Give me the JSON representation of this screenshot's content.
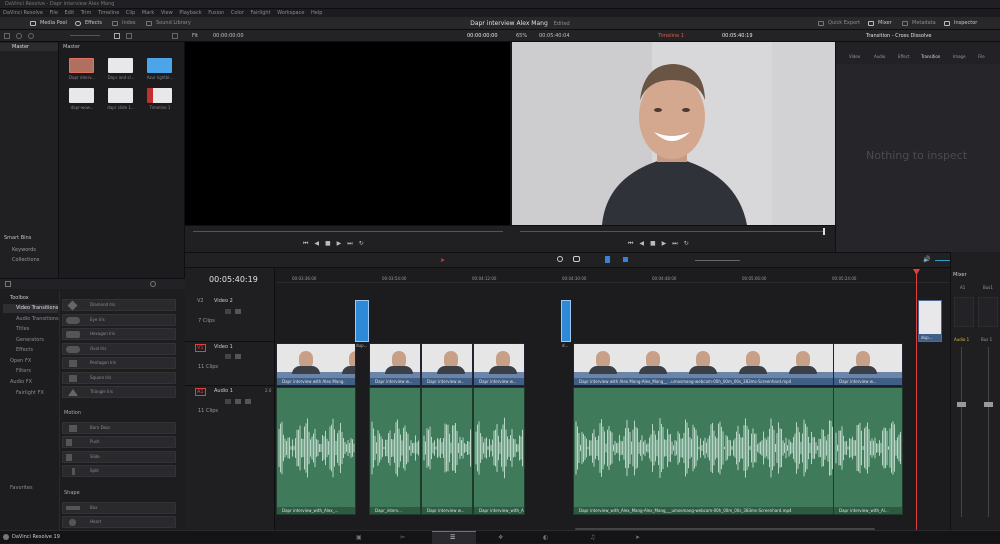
{
  "window": {
    "title": "DaVinci Resolve - Dapr interview Alex Mang"
  },
  "menu": [
    "DaVinci Resolve",
    "File",
    "Edit",
    "Trim",
    "Timeline",
    "Clip",
    "Mark",
    "View",
    "Playback",
    "Fusion",
    "Color",
    "Fairlight",
    "Workspace",
    "Help"
  ],
  "toolbar": {
    "media_pool": "Media Pool",
    "effects": "Effects",
    "index": "Index",
    "sound_library": "Sound Library",
    "project_title": "Dapr interview Alex Mang",
    "edited": "Edited",
    "quick_export": "Quick Export",
    "mixer": "Mixer",
    "metadata": "Metadata",
    "inspector": "Inspector"
  },
  "subbar": {
    "fit": "Fit",
    "src_tc": "00:00:00:00",
    "src_tc2": "00:00:00:00",
    "zoom": "65%",
    "duration": "00:05:40:04",
    "timeline_sel": "Timeline 1",
    "tl_tc": "00:05:40:19",
    "inspector_title": "Transition - Cross Dissolve"
  },
  "bins": {
    "master": "Master",
    "smart_bins": "Smart Bins",
    "keywords": "Keywords",
    "collections": "Collections"
  },
  "mediapool": {
    "header": "Master",
    "clips": [
      "Dapr interv...",
      "Dapr and sl...",
      "Azur lightbl...",
      "dapr-wow...",
      "dapr slide 1...",
      "Timeline 1"
    ]
  },
  "inspector": {
    "tabs": [
      "Video",
      "Audio",
      "Effect",
      "Transition",
      "Image",
      "File"
    ],
    "empty": "Nothing to inspect"
  },
  "effects": {
    "tree": [
      "Toolbox",
      "Video Transitions",
      "Audio Transitions",
      "Titles",
      "Generators",
      "Effects",
      "Open FX",
      "Filters",
      "Audio FX",
      "Fairlight FX"
    ],
    "favorites": "Favorites",
    "shape_items": [
      "Diamond Iris",
      "Eye Iris",
      "Hexagon Iris",
      "Oval Iris",
      "Pentagon Iris",
      "Square Iris",
      "Triangle Iris"
    ],
    "motion_header": "Motion",
    "motion_items": [
      "Barn Door",
      "Push",
      "Slide",
      "Split"
    ],
    "shape_header": "Shape",
    "shape2_items": [
      "Box",
      "Heart"
    ]
  },
  "timeline": {
    "timecode": "00:05:40:19",
    "ruler": [
      "00:03:36:00",
      "00:03:54:00",
      "00:04:12:00",
      "00:04:30:00",
      "00:04:48:00",
      "00:05:06:00",
      "00:05:24:00"
    ],
    "tracks": [
      {
        "id": "V2",
        "name": "Video 2",
        "clips": "7 Clips"
      },
      {
        "id": "V1",
        "name": "Video 1",
        "clips": "11 Clips"
      },
      {
        "id": "A1",
        "name": "Audio 1",
        "clips": "11 Clips",
        "ch": "2.0"
      }
    ],
    "v1_clips": [
      "Dapr interview with Alex Mang.",
      "Dapr interview w...",
      "Dapr interview w...",
      "Dapr interview w...",
      "Dapr interview with Alex Mang-Alex_Mang__...umosmang-webcam-00h_00m_00s_383ms-Screenhard.mp4",
      "Dapr interview w..."
    ],
    "a1_clips": [
      "Dapr interview_with_Alex_...",
      "Dapr_interv...",
      "Dapr interview w...",
      "Dapr interview_with_Alex_Mang-...",
      "Dapr interview_with_Alex_Mang-Alex_Mang___umosmang-webcam-00h_00m_00s_383ms-Screenhard.mp4",
      "Dapr interview_with_Al..."
    ],
    "v2_labels": [
      "dup...",
      "d...",
      "dup..."
    ]
  },
  "mixer": {
    "title": "Mixer",
    "a1": "A1",
    "bus1": "Bus1",
    "audio1": "Audio 1",
    "bus1b": "Bus 1",
    "db": "0.0"
  },
  "app": {
    "name": "DaVinci Resolve 19"
  },
  "colors": {
    "accent": "#c04040",
    "video_clip": "#6b85a8",
    "audio_clip": "#3f7a5a",
    "playhead": "#e0403a"
  }
}
